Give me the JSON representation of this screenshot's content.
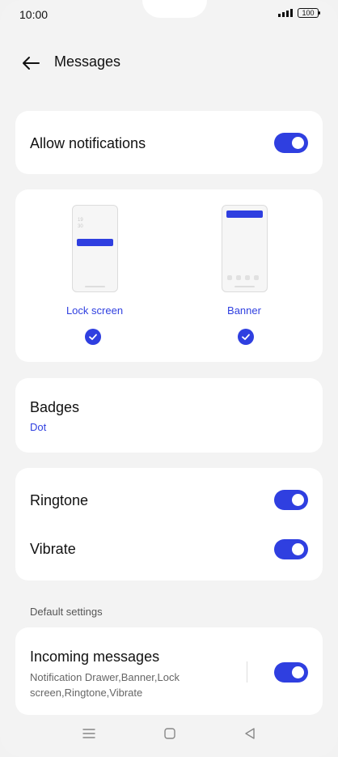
{
  "status_bar": {
    "time": "10:00",
    "battery": "100",
    "icons": [
      "signal-icon",
      "battery-icon"
    ]
  },
  "header": {
    "title": "Messages",
    "back_icon": "arrow-left-icon"
  },
  "allow_notifications": {
    "label": "Allow notifications",
    "enabled": true
  },
  "notification_styles": [
    {
      "label": "Lock screen",
      "checked": true,
      "preview_clock": [
        "19",
        "30"
      ]
    },
    {
      "label": "Banner",
      "checked": true
    }
  ],
  "badges": {
    "label": "Badges",
    "value": "Dot"
  },
  "ringtone": {
    "label": "Ringtone",
    "enabled": true
  },
  "vibrate": {
    "label": "Vibrate",
    "enabled": true
  },
  "default_settings": {
    "section_label": "Default settings",
    "incoming": {
      "label": "Incoming messages",
      "description": "Notification Drawer,Banner,Lock screen,Ringtone,Vibrate",
      "enabled": true
    }
  },
  "nav_bar": {
    "icons": [
      "menu-icon",
      "home-icon",
      "back-triangle-icon"
    ]
  },
  "colors": {
    "accent": "#2f3fe0",
    "background": "#f3f3f3",
    "card": "#ffffff"
  }
}
